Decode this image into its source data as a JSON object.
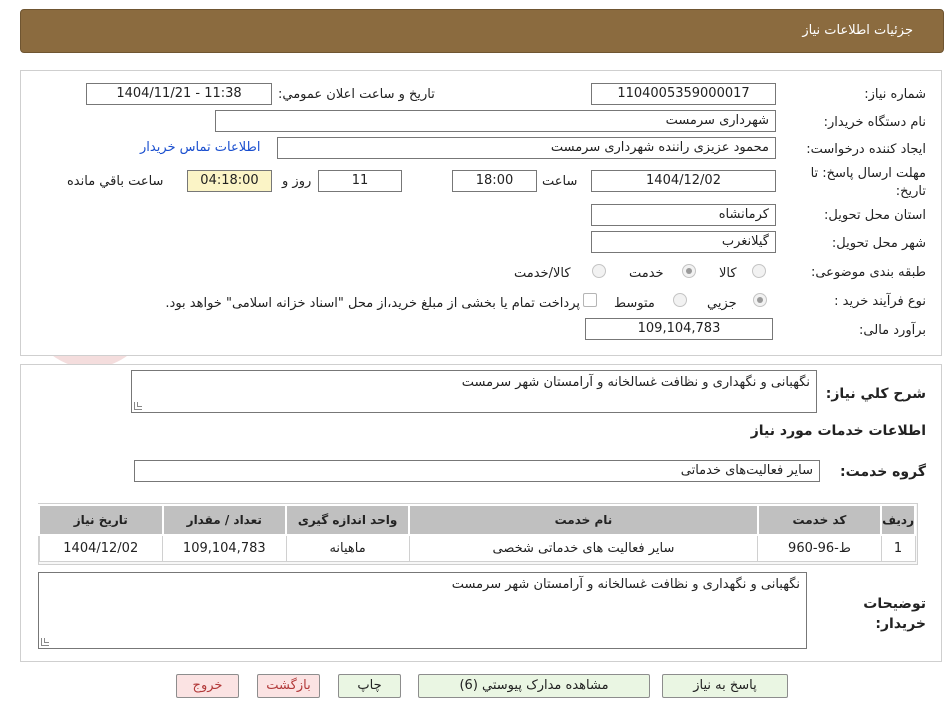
{
  "header": {
    "title": "جزئیات اطلاعات نیاز"
  },
  "form": {
    "need_number_label": "شماره نیاز:",
    "need_number": "1104005359000017",
    "announce_label": "تاریخ و ساعت اعلان عمومي:",
    "announce_value": "1404/11/21 - 11:38",
    "buyer_org_label": "نام دستگاه خريدار:",
    "buyer_org": "شهرداری سرمست",
    "requester_label": "ايجاد کننده درخواست:",
    "requester": "محمود عزیزی راننده شهرداری سرمست",
    "contact_link": "اطلاعات تماس خريدار",
    "deadline_label": "مهلت ارسال پاسخ: تا تاريخ:",
    "deadline_date": "1404/12/02",
    "time_label": "ساعت",
    "deadline_time": "18:00",
    "days_value": "11",
    "days_label": "روز و",
    "remaining_time": "04:18:00",
    "remaining_label": "ساعت باقي مانده",
    "province_label": "استان محل تحويل:",
    "province": "کرمانشاه",
    "city_label": "شهر محل تحويل:",
    "city": "گیلانغرب",
    "category_label": "طبقه بندی موضوعی:",
    "category_options": [
      "کالا",
      "خدمت",
      "کالا/خدمت"
    ],
    "category_selected": "خدمت",
    "process_label": "نوع فرآيند خريد :",
    "process_options": [
      "جزيي",
      "متوسط"
    ],
    "process_selected": "جزيي",
    "payment_note": "پرداخت تمام يا بخشی از مبلغ خريد،از محل \"اسناد خزانه اسلامی\" خواهد بود.",
    "budget_label": "برآورد مالی:",
    "budget": "109,104,783"
  },
  "details": {
    "summary_label": "شرح کلي نياز:",
    "summary": "نگهبانی و نگهداری و نظافت غسالخانه و آرامستان شهر سرمست",
    "services_title": "اطلاعات خدمات مورد نياز",
    "service_group_label": "گروه خدمت:",
    "service_group": "ساير فعاليت‌های خدماتی",
    "table": {
      "headers": [
        "رديف",
        "کد خدمت",
        "نام خدمت",
        "واحد اندازه گيری",
        "تعداد / مقدار",
        "تاريخ نياز"
      ],
      "rows": [
        [
          "1",
          "ط-96-960",
          "سایر فعالیت های خدماتی شخصی",
          "ماهیانه",
          "109,104,783",
          "1404/12/02"
        ]
      ]
    },
    "buyer_notes_label": "توضيحات خريدار:",
    "buyer_notes": "نگهبانی و نگهداری و نظافت غسالخانه و آرامستان شهر سرمست"
  },
  "buttons": {
    "reply": "پاسخ به نياز",
    "attachments": "مشاهده مدارک پيوستي (6)",
    "print": "چاپ",
    "back": "بازگشت",
    "exit": "خروج"
  },
  "colors": {
    "header_bg": "#8b6b3f",
    "highlight_field": "#fbf4c6",
    "button_bg": "#eaf6e3",
    "danger_bg": "#fbe3e3"
  }
}
